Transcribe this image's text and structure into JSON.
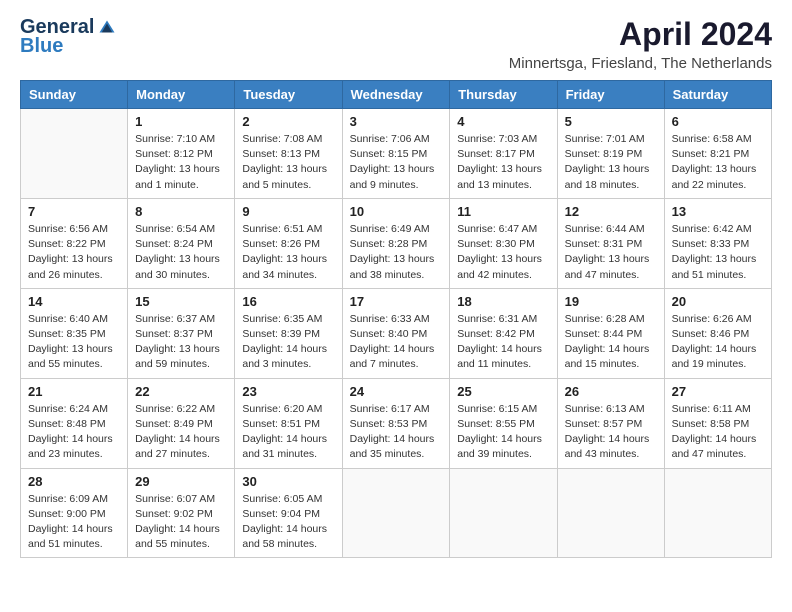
{
  "logo": {
    "general": "General",
    "blue": "Blue"
  },
  "title": "April 2024",
  "location": "Minnertsga, Friesland, The Netherlands",
  "days_of_week": [
    "Sunday",
    "Monday",
    "Tuesday",
    "Wednesday",
    "Thursday",
    "Friday",
    "Saturday"
  ],
  "weeks": [
    [
      {
        "day": "",
        "sunrise": "",
        "sunset": "",
        "daylight": "",
        "empty": true
      },
      {
        "day": "1",
        "sunrise": "Sunrise: 7:10 AM",
        "sunset": "Sunset: 8:12 PM",
        "daylight": "Daylight: 13 hours and 1 minute."
      },
      {
        "day": "2",
        "sunrise": "Sunrise: 7:08 AM",
        "sunset": "Sunset: 8:13 PM",
        "daylight": "Daylight: 13 hours and 5 minutes."
      },
      {
        "day": "3",
        "sunrise": "Sunrise: 7:06 AM",
        "sunset": "Sunset: 8:15 PM",
        "daylight": "Daylight: 13 hours and 9 minutes."
      },
      {
        "day": "4",
        "sunrise": "Sunrise: 7:03 AM",
        "sunset": "Sunset: 8:17 PM",
        "daylight": "Daylight: 13 hours and 13 minutes."
      },
      {
        "day": "5",
        "sunrise": "Sunrise: 7:01 AM",
        "sunset": "Sunset: 8:19 PM",
        "daylight": "Daylight: 13 hours and 18 minutes."
      },
      {
        "day": "6",
        "sunrise": "Sunrise: 6:58 AM",
        "sunset": "Sunset: 8:21 PM",
        "daylight": "Daylight: 13 hours and 22 minutes."
      }
    ],
    [
      {
        "day": "7",
        "sunrise": "Sunrise: 6:56 AM",
        "sunset": "Sunset: 8:22 PM",
        "daylight": "Daylight: 13 hours and 26 minutes."
      },
      {
        "day": "8",
        "sunrise": "Sunrise: 6:54 AM",
        "sunset": "Sunset: 8:24 PM",
        "daylight": "Daylight: 13 hours and 30 minutes."
      },
      {
        "day": "9",
        "sunrise": "Sunrise: 6:51 AM",
        "sunset": "Sunset: 8:26 PM",
        "daylight": "Daylight: 13 hours and 34 minutes."
      },
      {
        "day": "10",
        "sunrise": "Sunrise: 6:49 AM",
        "sunset": "Sunset: 8:28 PM",
        "daylight": "Daylight: 13 hours and 38 minutes."
      },
      {
        "day": "11",
        "sunrise": "Sunrise: 6:47 AM",
        "sunset": "Sunset: 8:30 PM",
        "daylight": "Daylight: 13 hours and 42 minutes."
      },
      {
        "day": "12",
        "sunrise": "Sunrise: 6:44 AM",
        "sunset": "Sunset: 8:31 PM",
        "daylight": "Daylight: 13 hours and 47 minutes."
      },
      {
        "day": "13",
        "sunrise": "Sunrise: 6:42 AM",
        "sunset": "Sunset: 8:33 PM",
        "daylight": "Daylight: 13 hours and 51 minutes."
      }
    ],
    [
      {
        "day": "14",
        "sunrise": "Sunrise: 6:40 AM",
        "sunset": "Sunset: 8:35 PM",
        "daylight": "Daylight: 13 hours and 55 minutes."
      },
      {
        "day": "15",
        "sunrise": "Sunrise: 6:37 AM",
        "sunset": "Sunset: 8:37 PM",
        "daylight": "Daylight: 13 hours and 59 minutes."
      },
      {
        "day": "16",
        "sunrise": "Sunrise: 6:35 AM",
        "sunset": "Sunset: 8:39 PM",
        "daylight": "Daylight: 14 hours and 3 minutes."
      },
      {
        "day": "17",
        "sunrise": "Sunrise: 6:33 AM",
        "sunset": "Sunset: 8:40 PM",
        "daylight": "Daylight: 14 hours and 7 minutes."
      },
      {
        "day": "18",
        "sunrise": "Sunrise: 6:31 AM",
        "sunset": "Sunset: 8:42 PM",
        "daylight": "Daylight: 14 hours and 11 minutes."
      },
      {
        "day": "19",
        "sunrise": "Sunrise: 6:28 AM",
        "sunset": "Sunset: 8:44 PM",
        "daylight": "Daylight: 14 hours and 15 minutes."
      },
      {
        "day": "20",
        "sunrise": "Sunrise: 6:26 AM",
        "sunset": "Sunset: 8:46 PM",
        "daylight": "Daylight: 14 hours and 19 minutes."
      }
    ],
    [
      {
        "day": "21",
        "sunrise": "Sunrise: 6:24 AM",
        "sunset": "Sunset: 8:48 PM",
        "daylight": "Daylight: 14 hours and 23 minutes."
      },
      {
        "day": "22",
        "sunrise": "Sunrise: 6:22 AM",
        "sunset": "Sunset: 8:49 PM",
        "daylight": "Daylight: 14 hours and 27 minutes."
      },
      {
        "day": "23",
        "sunrise": "Sunrise: 6:20 AM",
        "sunset": "Sunset: 8:51 PM",
        "daylight": "Daylight: 14 hours and 31 minutes."
      },
      {
        "day": "24",
        "sunrise": "Sunrise: 6:17 AM",
        "sunset": "Sunset: 8:53 PM",
        "daylight": "Daylight: 14 hours and 35 minutes."
      },
      {
        "day": "25",
        "sunrise": "Sunrise: 6:15 AM",
        "sunset": "Sunset: 8:55 PM",
        "daylight": "Daylight: 14 hours and 39 minutes."
      },
      {
        "day": "26",
        "sunrise": "Sunrise: 6:13 AM",
        "sunset": "Sunset: 8:57 PM",
        "daylight": "Daylight: 14 hours and 43 minutes."
      },
      {
        "day": "27",
        "sunrise": "Sunrise: 6:11 AM",
        "sunset": "Sunset: 8:58 PM",
        "daylight": "Daylight: 14 hours and 47 minutes."
      }
    ],
    [
      {
        "day": "28",
        "sunrise": "Sunrise: 6:09 AM",
        "sunset": "Sunset: 9:00 PM",
        "daylight": "Daylight: 14 hours and 51 minutes."
      },
      {
        "day": "29",
        "sunrise": "Sunrise: 6:07 AM",
        "sunset": "Sunset: 9:02 PM",
        "daylight": "Daylight: 14 hours and 55 minutes."
      },
      {
        "day": "30",
        "sunrise": "Sunrise: 6:05 AM",
        "sunset": "Sunset: 9:04 PM",
        "daylight": "Daylight: 14 hours and 58 minutes."
      },
      {
        "day": "",
        "sunrise": "",
        "sunset": "",
        "daylight": "",
        "empty": true
      },
      {
        "day": "",
        "sunrise": "",
        "sunset": "",
        "daylight": "",
        "empty": true
      },
      {
        "day": "",
        "sunrise": "",
        "sunset": "",
        "daylight": "",
        "empty": true
      },
      {
        "day": "",
        "sunrise": "",
        "sunset": "",
        "daylight": "",
        "empty": true
      }
    ]
  ]
}
